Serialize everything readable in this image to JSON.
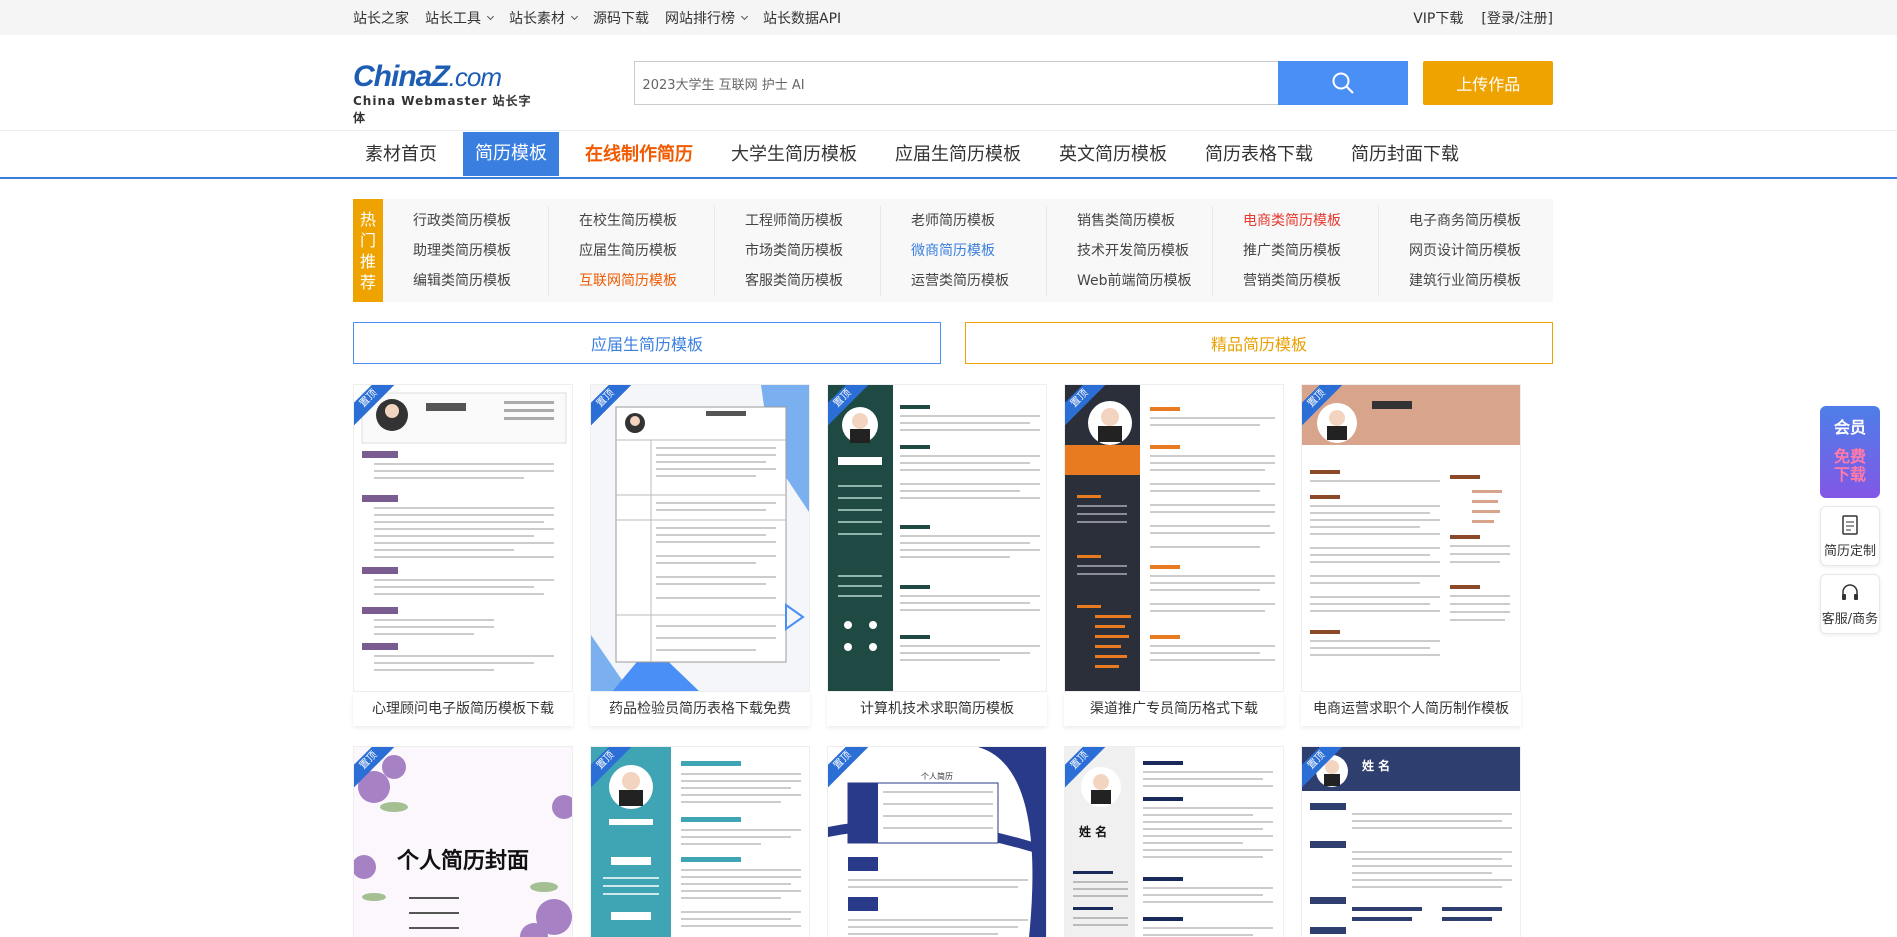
{
  "topbar": {
    "links": [
      {
        "label": "站长之家",
        "dropdown": false
      },
      {
        "label": "站长工具",
        "dropdown": true
      },
      {
        "label": "站长素材",
        "dropdown": true
      },
      {
        "label": "源码下载",
        "dropdown": false
      },
      {
        "label": "网站排行榜",
        "dropdown": true
      },
      {
        "label": "站长数据API",
        "dropdown": false
      }
    ],
    "vip": "VIP下载",
    "login": "[登录/注册]"
  },
  "header": {
    "logo_main": "ChinaZ",
    "logo_domain": ".com",
    "logo_sub": "China Webmaster 站长字体",
    "search_value": "2023大学生 互联网 护士 AI",
    "upload_label": "上传作品"
  },
  "nav": [
    {
      "label": "素材首页",
      "state": "normal"
    },
    {
      "label": "简历模板",
      "state": "active"
    },
    {
      "label": "在线制作简历",
      "state": "hot"
    },
    {
      "label": "大学生简历模板",
      "state": "normal"
    },
    {
      "label": "应届生简历模板",
      "state": "normal"
    },
    {
      "label": "英文简历模板",
      "state": "normal"
    },
    {
      "label": "简历表格下载",
      "state": "normal"
    },
    {
      "label": "简历封面下载",
      "state": "normal"
    }
  ],
  "hot": {
    "label": [
      "热",
      "门",
      "推",
      "荐"
    ],
    "links": [
      {
        "label": "行政类简历模板",
        "color": ""
      },
      {
        "label": "在校生简历模板",
        "color": ""
      },
      {
        "label": "工程师简历模板",
        "color": ""
      },
      {
        "label": "老师简历模板",
        "color": ""
      },
      {
        "label": "销售类简历模板",
        "color": ""
      },
      {
        "label": "电商类简历模板",
        "color": "red"
      },
      {
        "label": "电子商务简历模板",
        "color": ""
      },
      {
        "label": "助理类简历模板",
        "color": ""
      },
      {
        "label": "应届生简历模板",
        "color": ""
      },
      {
        "label": "市场类简历模板",
        "color": ""
      },
      {
        "label": "微商简历模板",
        "color": "blue"
      },
      {
        "label": "技术开发简历模板",
        "color": ""
      },
      {
        "label": "推广类简历模板",
        "color": ""
      },
      {
        "label": "网页设计简历模板",
        "color": ""
      },
      {
        "label": "编辑类简历模板",
        "color": ""
      },
      {
        "label": "互联网简历模板",
        "color": "orange"
      },
      {
        "label": "客服类简历模板",
        "color": ""
      },
      {
        "label": "运营类简历模板",
        "color": ""
      },
      {
        "label": "Web前端简历模板",
        "color": ""
      },
      {
        "label": "营销类简历模板",
        "color": ""
      },
      {
        "label": "建筑行业简历模板",
        "color": ""
      }
    ]
  },
  "categories": {
    "graduate": "应届生简历模板",
    "premium": "精品简历模板"
  },
  "ribbon": "置顶",
  "cards_row1": [
    {
      "title": "心理顾问电子版简历模板下载",
      "theme": "gray"
    },
    {
      "title": "药品检验员简历表格下载免费",
      "theme": "blue"
    },
    {
      "title": "计算机技术求职简历模板",
      "theme": "green"
    },
    {
      "title": "渠道推广专员简历格式下载",
      "theme": "dark"
    },
    {
      "title": "电商运营求职个人简历制作模板",
      "theme": "brown"
    }
  ],
  "cards_row2": [
    {
      "title": "个人简历封面",
      "theme": "floral"
    },
    {
      "title": "",
      "theme": "teal"
    },
    {
      "title": "个人简历",
      "theme": "navy"
    },
    {
      "title": "姓 名",
      "theme": "white"
    },
    {
      "title": "姓 名",
      "theme": "navyhead"
    }
  ],
  "side": {
    "vip_title": "会员",
    "vip_free": "免费",
    "vip_dl": "下载",
    "resume_custom": "简历定制",
    "service": "客服/商务"
  }
}
